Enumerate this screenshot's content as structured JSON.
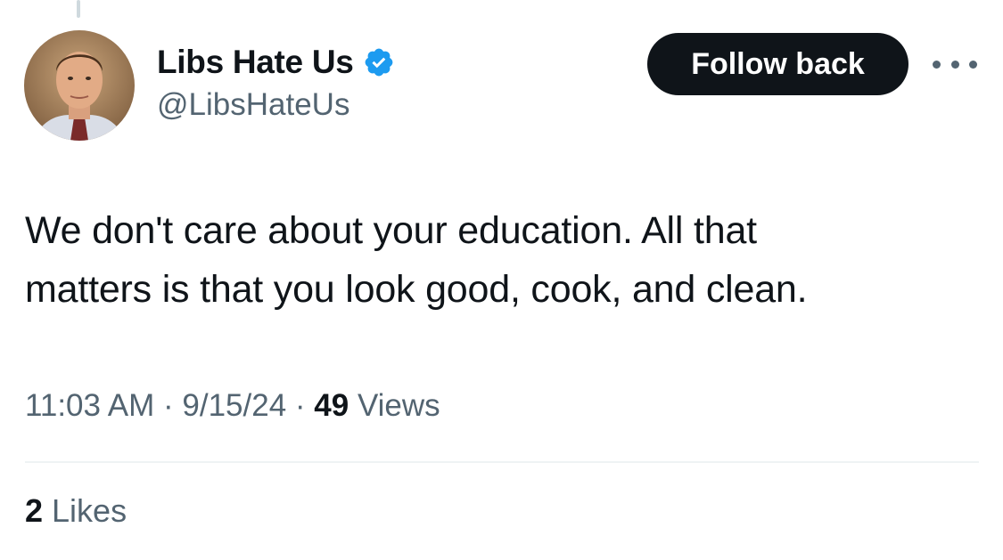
{
  "author": {
    "display_name": "Libs Hate Us",
    "handle": "@LibsHateUs",
    "verified_icon": "verified-badge-icon",
    "verified_color": "#1d9bf0"
  },
  "actions": {
    "follow_label": "Follow back",
    "more_icon": "more-options-icon"
  },
  "tweet": {
    "text_line1": "We don't care about your education. All that",
    "text_line2": "matters is that you look good, cook, and clean."
  },
  "meta": {
    "time": "11:03 AM",
    "separator": " · ",
    "date": "9/15/24",
    "views_count": "49",
    "views_label": " Views"
  },
  "engagement": {
    "likes_count": "2",
    "likes_label": " Likes"
  },
  "colors": {
    "primary_text": "#0f1419",
    "secondary_text": "#536471",
    "button_bg": "#0f1419",
    "divider": "#eff3f4"
  }
}
